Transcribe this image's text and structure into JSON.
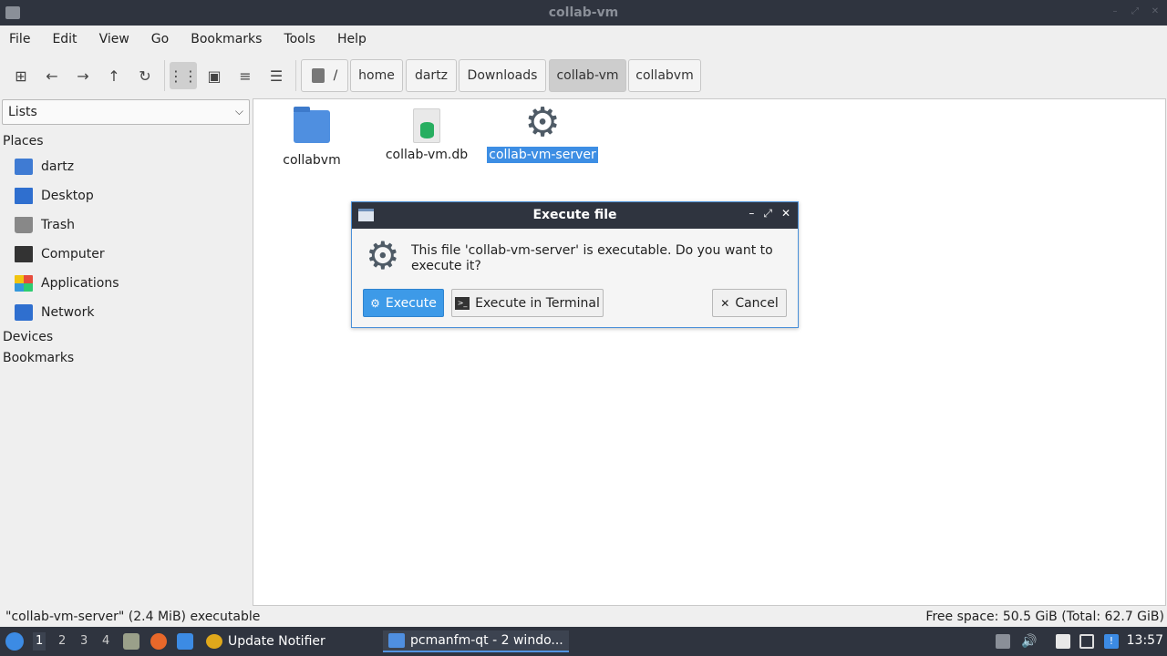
{
  "window": {
    "title": "collab-vm"
  },
  "menubar": [
    "File",
    "Edit",
    "View",
    "Go",
    "Bookmarks",
    "Tools",
    "Help"
  ],
  "breadcrumbs": [
    {
      "label": "/"
    },
    {
      "label": "home"
    },
    {
      "label": "dartz"
    },
    {
      "label": "Downloads"
    },
    {
      "label": "collab-vm",
      "active": true
    },
    {
      "label": "collabvm"
    }
  ],
  "sidepane": {
    "select_value": "Lists",
    "places_header": "Places",
    "places": [
      {
        "label": "dartz",
        "icon": "home-folder-icon"
      },
      {
        "label": "Desktop",
        "icon": "desktop-icon"
      },
      {
        "label": "Trash",
        "icon": "trash-icon"
      },
      {
        "label": "Computer",
        "icon": "computer-icon"
      },
      {
        "label": "Applications",
        "icon": "applications-icon"
      },
      {
        "label": "Network",
        "icon": "network-icon"
      }
    ],
    "devices_header": "Devices",
    "bookmarks_header": "Bookmarks"
  },
  "files": [
    {
      "name": "collabvm",
      "icon": "folder-icon",
      "selected": false
    },
    {
      "name": "collab-vm.db",
      "icon": "database-file-icon",
      "selected": false
    },
    {
      "name": "collab-vm-server",
      "icon": "gear-executable-icon",
      "selected": true
    }
  ],
  "dialog": {
    "title": "Execute file",
    "message": "This file 'collab-vm-server' is executable. Do you want to execute it?",
    "execute_label": "Execute",
    "terminal_label": "Execute in Terminal",
    "cancel_label": "Cancel"
  },
  "statusbar": {
    "left": "\"collab-vm-server\" (2.4 MiB) executable",
    "right": "Free space: 50.5 GiB (Total: 62.7 GiB)"
  },
  "taskbar": {
    "desktops": [
      "1",
      "2",
      "3",
      "4"
    ],
    "update_notifier": "Update Notifier",
    "pcmanfm_task": "pcmanfm-qt - 2 windo...",
    "clock": "13:57"
  },
  "colors": {
    "accent": "#3d9ae8",
    "titlebar": "#2f343f",
    "selection": "#3d8ee4"
  }
}
